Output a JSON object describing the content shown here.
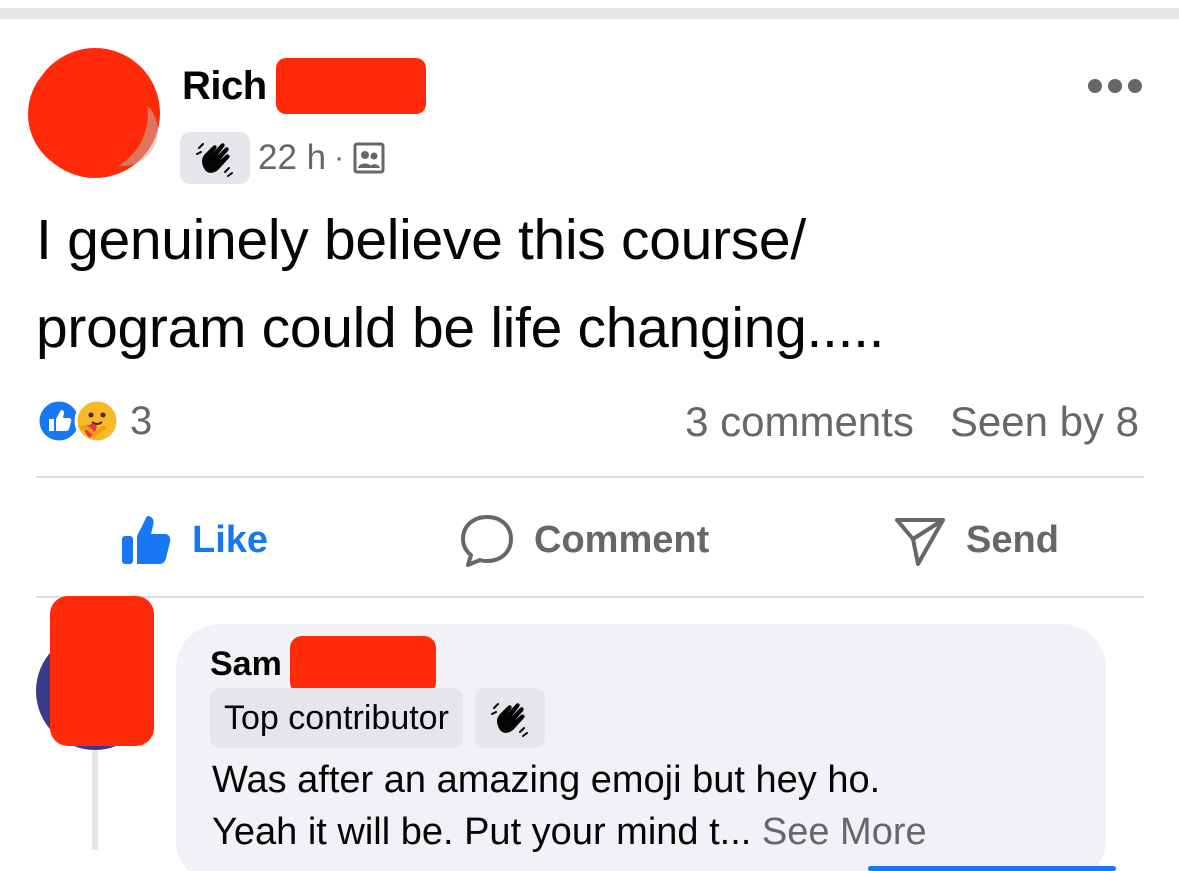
{
  "colors": {
    "accent": "#1877f2",
    "muted": "#65676b",
    "bubble": "#f0f2f5",
    "redaction": "#ff2a0a"
  },
  "post": {
    "author_name": "Rich",
    "time": "22 h",
    "separator": "·",
    "badge_icon": "wave-icon",
    "audience_icon": "group-icon",
    "text_lines": [
      "I genuinely believe this course/",
      "program could be life changing....."
    ],
    "reaction_count": "3",
    "comments_count": "3 comments",
    "seen_by": "Seen by 8"
  },
  "actions": {
    "like": "Like",
    "comment": "Comment",
    "send": "Send"
  },
  "comment": {
    "author_name": "Sam",
    "badge": "Top contributor",
    "text_line1": "Was after an amazing emoji but hey ho.",
    "text_line2": "Yeah it will be. Put your mind t...",
    "see_more": "See More"
  }
}
